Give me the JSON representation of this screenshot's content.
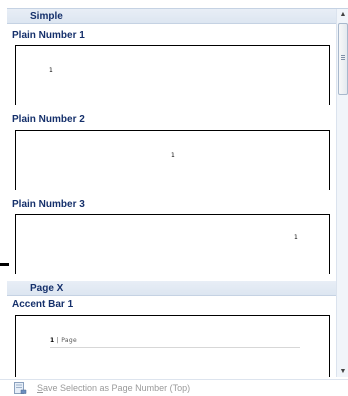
{
  "sections": [
    {
      "header": "Simple"
    },
    {
      "header": "Page X"
    }
  ],
  "items": [
    {
      "title": "Plain Number 1",
      "preview_number": "1"
    },
    {
      "title": "Plain Number 2",
      "preview_number": "1"
    },
    {
      "title": "Plain Number 3",
      "preview_number": "1"
    },
    {
      "title": "Accent Bar 1",
      "preview_number": "1",
      "preview_text": "Page"
    }
  ],
  "scrollbar": {
    "up_icon": "▲",
    "down_icon": "▼"
  },
  "footer": {
    "label_first": "S",
    "label_rest": "ave Selection as Page Number (Top)",
    "icon": "save-selection-icon"
  },
  "colors": {
    "header_text": "#15306b",
    "header_bg": "#e1e9f3",
    "disabled_text": "#9a9a9a"
  }
}
